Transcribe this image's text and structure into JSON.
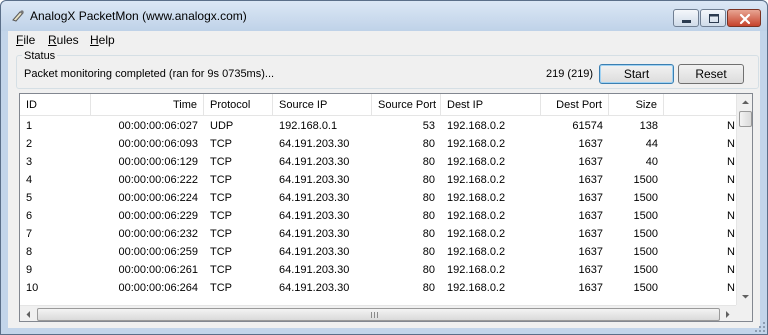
{
  "window": {
    "title": "AnalogX PacketMon (www.analogx.com)"
  },
  "menu": [
    {
      "accel": "F",
      "rest": "ile"
    },
    {
      "accel": "R",
      "rest": "ules"
    },
    {
      "accel": "H",
      "rest": "elp"
    }
  ],
  "status": {
    "group_label": "Status",
    "message": "Packet monitoring completed (ran for  9s 0735ms)...",
    "count": "219 (219)",
    "start_label": "Start",
    "reset_label": "Reset"
  },
  "table": {
    "columns": [
      "ID",
      "Time",
      "Protocol",
      "Source IP",
      "Source Port",
      "Dest IP",
      "Dest Port",
      "Size",
      ""
    ],
    "rows": [
      [
        "1",
        "00:00:00:06:027",
        "UDP",
        "192.168.0.1",
        "53",
        "192.168.0.2",
        "61574",
        "138",
        "N"
      ],
      [
        "2",
        "00:00:00:06:093",
        "TCP",
        "64.191.203.30",
        "80",
        "192.168.0.2",
        "1637",
        "44",
        "N"
      ],
      [
        "3",
        "00:00:00:06:129",
        "TCP",
        "64.191.203.30",
        "80",
        "192.168.0.2",
        "1637",
        "40",
        "N"
      ],
      [
        "4",
        "00:00:00:06:222",
        "TCP",
        "64.191.203.30",
        "80",
        "192.168.0.2",
        "1637",
        "1500",
        "N"
      ],
      [
        "5",
        "00:00:00:06:224",
        "TCP",
        "64.191.203.30",
        "80",
        "192.168.0.2",
        "1637",
        "1500",
        "N"
      ],
      [
        "6",
        "00:00:00:06:229",
        "TCP",
        "64.191.203.30",
        "80",
        "192.168.0.2",
        "1637",
        "1500",
        "N"
      ],
      [
        "7",
        "00:00:00:06:232",
        "TCP",
        "64.191.203.30",
        "80",
        "192.168.0.2",
        "1637",
        "1500",
        "N"
      ],
      [
        "8",
        "00:00:00:06:259",
        "TCP",
        "64.191.203.30",
        "80",
        "192.168.0.2",
        "1637",
        "1500",
        "N"
      ],
      [
        "9",
        "00:00:00:06:261",
        "TCP",
        "64.191.203.30",
        "80",
        "192.168.0.2",
        "1637",
        "1500",
        "N"
      ],
      [
        "10",
        "00:00:00:06:264",
        "TCP",
        "64.191.203.30",
        "80",
        "192.168.0.2",
        "1637",
        "1500",
        "N"
      ]
    ]
  },
  "icons": {
    "app": "packet-monitor-icon",
    "minimize": "minimize-icon",
    "maximize": "maximize-icon",
    "close": "close-icon"
  },
  "colors": {
    "close_button": "#c6432c",
    "start_focus": "#3c7fb1"
  }
}
